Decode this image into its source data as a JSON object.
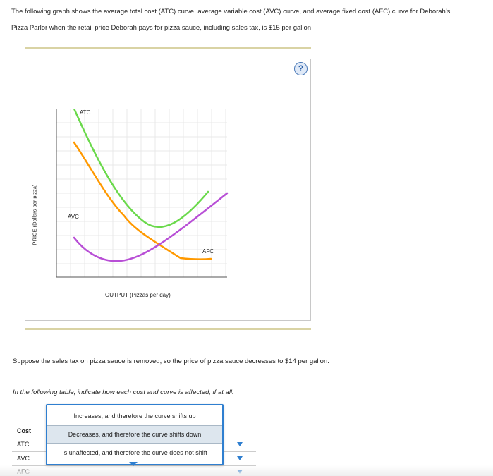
{
  "intro": {
    "line1": "The following graph shows the average total cost (ATC) curve, average variable cost (AVC) curve, and average fixed cost (AFC) curve for Deborah's",
    "line2": "Pizza Parlor when the retail price Deborah pays for pizza sauce, including sales tax, is $15 per gallon."
  },
  "graph": {
    "help_glyph": "?",
    "y_axis_label": "PRICE (Dollars per pizza)",
    "x_axis_label": "OUTPUT (Pizzas per day)",
    "curve_labels": {
      "atc": "ATC",
      "avc": "AVC",
      "afc": "AFC"
    },
    "colors": {
      "atc": "#6ad94b",
      "avc": "#b84fd6",
      "afc": "#ff9900",
      "grid": "#e9e9e9",
      "axis": "#555555"
    }
  },
  "paragraph": "Suppose the sales tax on pizza sauce is removed, so the price of pizza sauce decreases to $14 per gallon.",
  "instruction": "In the following table, indicate how each cost and curve is affected, if at all.",
  "table": {
    "header": "Cost",
    "rows": [
      {
        "label": "ATC"
      },
      {
        "label": "AVC"
      },
      {
        "label": "AFC"
      }
    ]
  },
  "dropdown": {
    "options": [
      "Increases, and therefore the curve shifts up",
      "Decreases, and therefore the curve shifts down",
      "Is unaffected, and therefore the curve does not shift"
    ],
    "highlighted_index": 1
  }
}
